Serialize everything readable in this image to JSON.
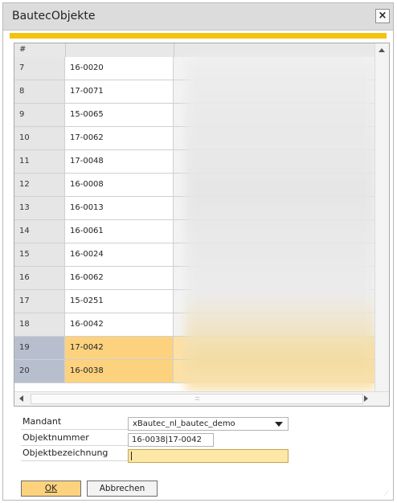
{
  "window": {
    "title": "BautecObjekte",
    "close_label": "×"
  },
  "grid": {
    "header_num": "#",
    "rows": [
      {
        "num": "7",
        "code": "16-0020",
        "selected": false
      },
      {
        "num": "8",
        "code": "17-0071",
        "selected": false
      },
      {
        "num": "9",
        "code": "15-0065",
        "selected": false
      },
      {
        "num": "10",
        "code": "17-0062",
        "selected": false
      },
      {
        "num": "11",
        "code": "17-0048",
        "selected": false
      },
      {
        "num": "12",
        "code": "16-0008",
        "selected": false
      },
      {
        "num": "13",
        "code": "16-0013",
        "selected": false
      },
      {
        "num": "14",
        "code": "16-0061",
        "selected": false
      },
      {
        "num": "15",
        "code": "16-0024",
        "selected": false
      },
      {
        "num": "16",
        "code": "16-0062",
        "selected": false
      },
      {
        "num": "17",
        "code": "15-0251",
        "selected": false
      },
      {
        "num": "18",
        "code": "16-0042",
        "selected": false
      },
      {
        "num": "19",
        "code": "17-0042",
        "selected": true
      },
      {
        "num": "20",
        "code": "16-0038",
        "selected": true
      }
    ],
    "hscroll_thumb_glyph": ":::"
  },
  "form": {
    "mandant_label": "Mandant",
    "mandant_value": "xBautec_nl_bautec_demo",
    "objektnummer_label": "Objektnummer",
    "objektnummer_value": "16-0038|17-0042",
    "objektbezeichnung_label": "Objektbezeichnung",
    "objektbezeichnung_value": ""
  },
  "buttons": {
    "ok": "OK",
    "ok_mnemonic": "O",
    "cancel": "Abbrechen",
    "cancel_mnemonic": "A"
  },
  "colors": {
    "accent": "#f5c20f",
    "selected_code": "#fcd27f",
    "selected_num": "#b7bfcf",
    "ok_button": "#fcd27f"
  }
}
